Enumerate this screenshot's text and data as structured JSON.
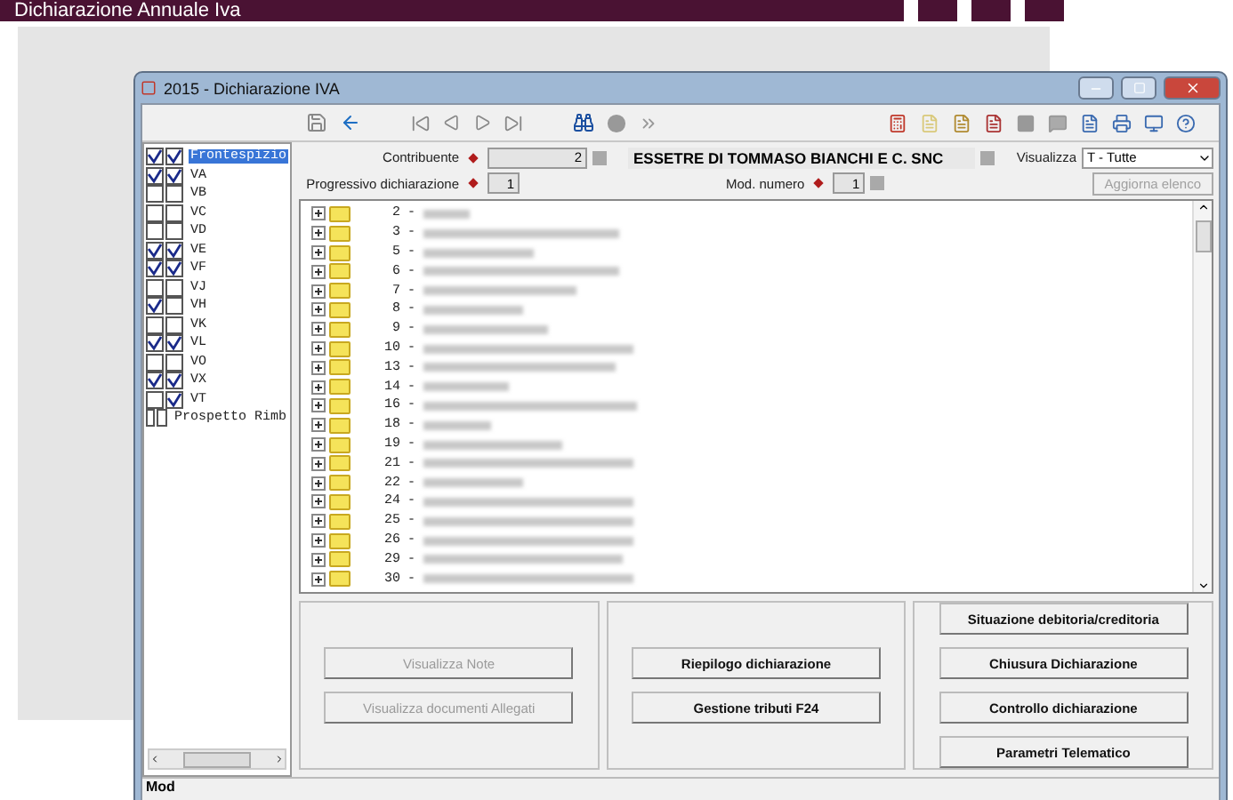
{
  "page_header": {
    "title": "Dichiarazione Annuale Iva"
  },
  "window": {
    "title": "2015 - Dichiarazione IVA"
  },
  "sidebar": {
    "items": [
      {
        "label": "Frontespizio",
        "check_1": true,
        "check_2": true,
        "selected": true
      },
      {
        "label": "VA",
        "check_1": true,
        "check_2": true,
        "selected": false
      },
      {
        "label": "VB",
        "check_1": false,
        "check_2": false,
        "selected": false
      },
      {
        "label": "VC",
        "check_1": false,
        "check_2": false,
        "selected": false
      },
      {
        "label": "VD",
        "check_1": false,
        "check_2": false,
        "selected": false
      },
      {
        "label": "VE",
        "check_1": true,
        "check_2": true,
        "selected": false
      },
      {
        "label": "VF",
        "check_1": true,
        "check_2": true,
        "selected": false
      },
      {
        "label": "VJ",
        "check_1": false,
        "check_2": false,
        "selected": false
      },
      {
        "label": "VH",
        "check_1": true,
        "check_2": false,
        "selected": false
      },
      {
        "label": "VK",
        "check_1": false,
        "check_2": false,
        "selected": false
      },
      {
        "label": "VL",
        "check_1": true,
        "check_2": true,
        "selected": false
      },
      {
        "label": "VO",
        "check_1": false,
        "check_2": false,
        "selected": false
      },
      {
        "label": "VX",
        "check_1": true,
        "check_2": true,
        "selected": false
      },
      {
        "label": "VT",
        "check_1": false,
        "check_2": true,
        "selected": false
      },
      {
        "label": "Prospetto Rimb",
        "check_1": false,
        "check_2": false,
        "selected": false
      }
    ]
  },
  "form": {
    "contribuente_label": "Contribuente",
    "contribuente_value": "2",
    "company_name": "ESSETRE DI TOMMASO BIANCHI E C. SNC",
    "visualizza_label": "Visualizza",
    "visualizza_value": "T  - Tutte",
    "progressivo_label": "Progressivo dichiarazione",
    "progressivo_value": "1",
    "mod_label": "Mod. numero",
    "mod_value": "1",
    "refresh_button": {
      "label": "Aggiorna elenco",
      "disabled": true
    }
  },
  "list": {
    "rows": [
      {
        "number": "2",
        "separator": "-"
      },
      {
        "number": "3",
        "separator": "-"
      },
      {
        "number": "5",
        "separator": "-"
      },
      {
        "number": "6",
        "separator": "-"
      },
      {
        "number": "7",
        "separator": "-"
      },
      {
        "number": "8",
        "separator": "-"
      },
      {
        "number": "9",
        "separator": "-"
      },
      {
        "number": "10",
        "separator": "-"
      },
      {
        "number": "13",
        "separator": "-"
      },
      {
        "number": "14",
        "separator": "-"
      },
      {
        "number": "16",
        "separator": "-"
      },
      {
        "number": "18",
        "separator": "-"
      },
      {
        "number": "19",
        "separator": "-"
      },
      {
        "number": "21",
        "separator": "-"
      },
      {
        "number": "22",
        "separator": "-"
      },
      {
        "number": "24",
        "separator": "-"
      },
      {
        "number": "25",
        "separator": "-"
      },
      {
        "number": "26",
        "separator": "-"
      },
      {
        "number": "29",
        "separator": "-"
      },
      {
        "number": "30",
        "separator": "-"
      }
    ]
  },
  "button_groups": [
    [
      {
        "label": "Visualizza Note",
        "disabled": true
      },
      {
        "label": "Visualizza documenti Allegati",
        "disabled": true
      }
    ],
    [
      {
        "label": "Riepilogo dichiarazione",
        "disabled": false
      },
      {
        "label": "Gestione tributi F24",
        "disabled": false
      }
    ],
    [
      {
        "label": "Situazione debitoria/creditoria",
        "disabled": false
      },
      {
        "label": "Chiusura Dichiarazione",
        "disabled": false
      },
      {
        "label": "Controllo dichiarazione",
        "disabled": false
      },
      {
        "label": "Parametri Telematico",
        "disabled": false
      }
    ]
  ],
  "status_bar": {
    "text": "Mod"
  }
}
